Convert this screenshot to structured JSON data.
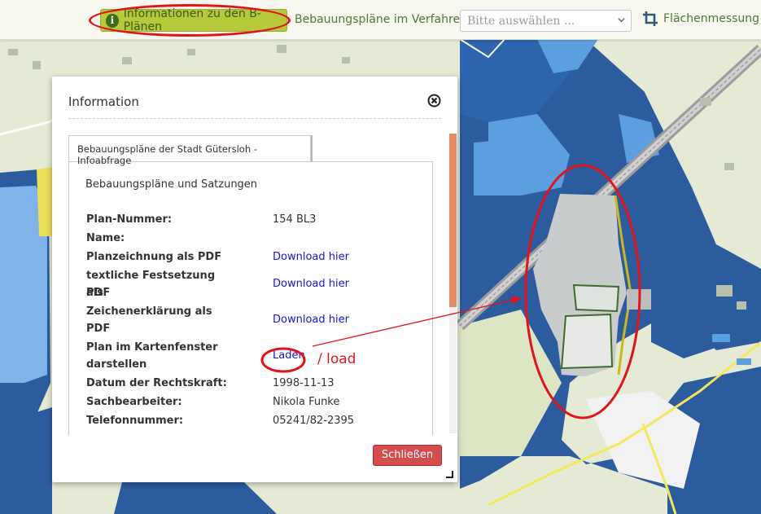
{
  "toolbar": {
    "info_button_label": "Informationen zu den B-Plänen",
    "procedures_link": "Bebauungspläne im Verfahren",
    "select_placeholder": "Bitte auswählen ...",
    "measure_label": "Flächenmessung"
  },
  "dialog": {
    "title": "Information",
    "tab_label": "Bebauungspläne der Stadt Gütersloh - Infoabfrage",
    "section_title": "Bebauungspläne und Satzungen",
    "rows": [
      {
        "label": "Plan-Nummer:",
        "value": "154 BL3"
      },
      {
        "label": "Name:",
        "value": ""
      },
      {
        "label": "Planzeichnung als PDF",
        "value": "Download hier"
      },
      {
        "label_line1": "textliche Festsetzung als",
        "label_line2": "PDF",
        "value": "Download hier"
      },
      {
        "label_line1": "Zeichenerklärung als",
        "label_line2": "PDF",
        "value": "Download hier"
      },
      {
        "label_line1": "Plan im Kartenfenster",
        "label_line2": "darstellen",
        "value": "Laden"
      },
      {
        "label": "Datum der Rechtskraft:",
        "value": "1998-11-13"
      },
      {
        "label": "Sachbearbeiter:",
        "value": "Nikola Funke"
      },
      {
        "label": "Telefonnummer:",
        "value": "05241/82-2395"
      }
    ],
    "close_button": "Schließen"
  },
  "annotation": {
    "load_text": "/ load",
    "highlight_color": "#e0141a"
  },
  "colors": {
    "accent_green": "#b5c93a",
    "map_blue_dark": "#2e5fa3",
    "map_blue_light": "#5b9fe0",
    "close_button_red": "#d44c4c",
    "link_blue": "#1717cc"
  }
}
